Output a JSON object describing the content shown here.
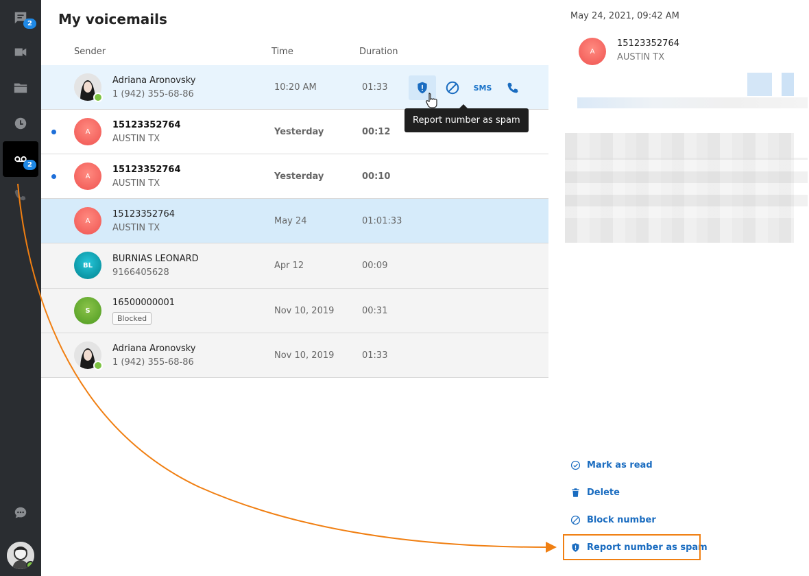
{
  "sidebar": {
    "chat_badge": "2",
    "voicemail_badge": "2",
    "icons": [
      "chat-icon",
      "video-icon",
      "folder-icon",
      "history-icon",
      "voicemail-icon",
      "call-transfer-icon",
      "support-chat-icon"
    ]
  },
  "main": {
    "title": "My voicemails",
    "columns": {
      "sender": "Sender",
      "time": "Time",
      "duration": "Duration"
    },
    "rows": [
      {
        "name": "Adriana Aronovsky",
        "sub": "1 (942) 355-68-86",
        "time": "10:20 AM",
        "duration": "01:33",
        "avatar": "photo",
        "state": "hover"
      },
      {
        "name": "15123352764",
        "sub": "AUSTIN TX",
        "time": "Yesterday",
        "duration": "00:12",
        "avatar": "A",
        "state": "unread"
      },
      {
        "name": "15123352764",
        "sub": "AUSTIN TX",
        "time": "Yesterday",
        "duration": "00:10",
        "avatar": "A",
        "state": "unread"
      },
      {
        "name": "15123352764",
        "sub": "AUSTIN TX",
        "time": "May 24",
        "duration": "01:01:33",
        "avatar": "A",
        "state": "selected"
      },
      {
        "name": "BURNIAS LEONARD",
        "sub": "9166405628",
        "time": "Apr 12",
        "duration": "00:09",
        "avatar": "BL",
        "state": "read"
      },
      {
        "name": "16500000001",
        "sub": "Blocked",
        "time": "Nov 10, 2019",
        "duration": "00:31",
        "avatar": "S",
        "state": "read"
      },
      {
        "name": "Adriana Aronovsky",
        "sub": "1 (942) 355-68-86",
        "time": "Nov 10, 2019",
        "duration": "01:33",
        "avatar": "photo",
        "state": "read"
      }
    ],
    "row_actions": {
      "sms": "SMS"
    },
    "tooltip": "Report number as spam"
  },
  "detail": {
    "date": "May 24, 2021, 09:42 AM",
    "avatar_letter": "A",
    "number": "15123352764",
    "location": "AUSTIN TX",
    "actions": {
      "mark_read": "Mark as read",
      "delete": "Delete",
      "block": "Block number",
      "report_spam": "Report number as spam"
    }
  },
  "colors": {
    "accent": "#1a6cc0",
    "sidebar_bg": "#2a2d31",
    "highlight": "#f07f12",
    "online": "#7cc242"
  }
}
